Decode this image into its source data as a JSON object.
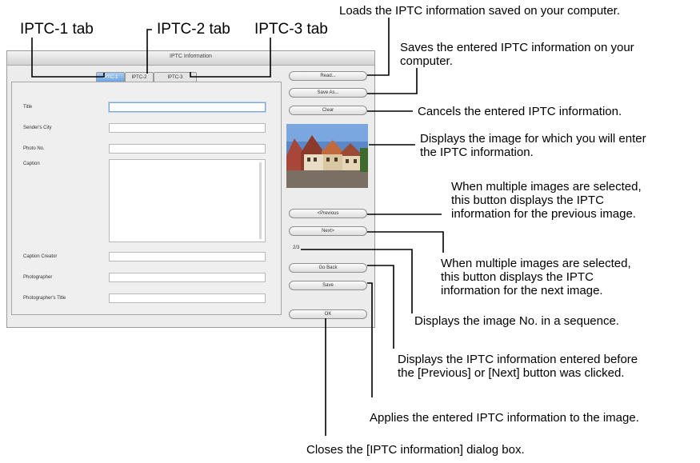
{
  "labels": {
    "iptc1_tab": "IPTC-1 tab",
    "iptc2_tab": "IPTC-2 tab",
    "iptc3_tab": "IPTC-3 tab"
  },
  "callouts": {
    "read": "Loads the IPTC information saved on your computer.",
    "save_as_1": "Saves the entered IPTC information on your",
    "save_as_2": "computer.",
    "clear": "Cancels the entered IPTC information.",
    "image_1": "Displays the image for which you will enter",
    "image_2": "the IPTC information.",
    "previous_1": "When multiple images are selected,",
    "previous_2": "this button displays the IPTC",
    "previous_3": "information for the previous image.",
    "next_1": "When multiple images are selected,",
    "next_2": "this button displays the IPTC",
    "next_3": "information for the next image.",
    "counter": "Displays the image No. in a sequence.",
    "go_back_1": "Displays the IPTC information entered before",
    "go_back_2": "the [Previous] or [Next] button was clicked.",
    "save": "Applies the entered IPTC information to the image.",
    "ok": "Closes the [IPTC information] dialog box."
  },
  "dialog": {
    "title": "IPTC Information",
    "tabs": [
      "IPTC-1",
      "IPTC-2",
      "IPTC-3"
    ],
    "fields": {
      "title": "Title",
      "senders_city": "Sender's City",
      "photo_no": "Photo No.",
      "caption": "Caption",
      "caption_creator": "Caption Creator",
      "photographer": "Photographer",
      "photographers_title": "Photographer's Title"
    },
    "buttons": {
      "read": "Read...",
      "save_as": "Save As...",
      "clear": "Clear",
      "previous": "<Previous",
      "next": "Next>",
      "go_back": "Go Back",
      "save": "Save",
      "ok": "OK"
    },
    "counter": "2/3"
  },
  "colors": {
    "active_tab": "#6fa4dd",
    "leader_line": "#000000"
  }
}
